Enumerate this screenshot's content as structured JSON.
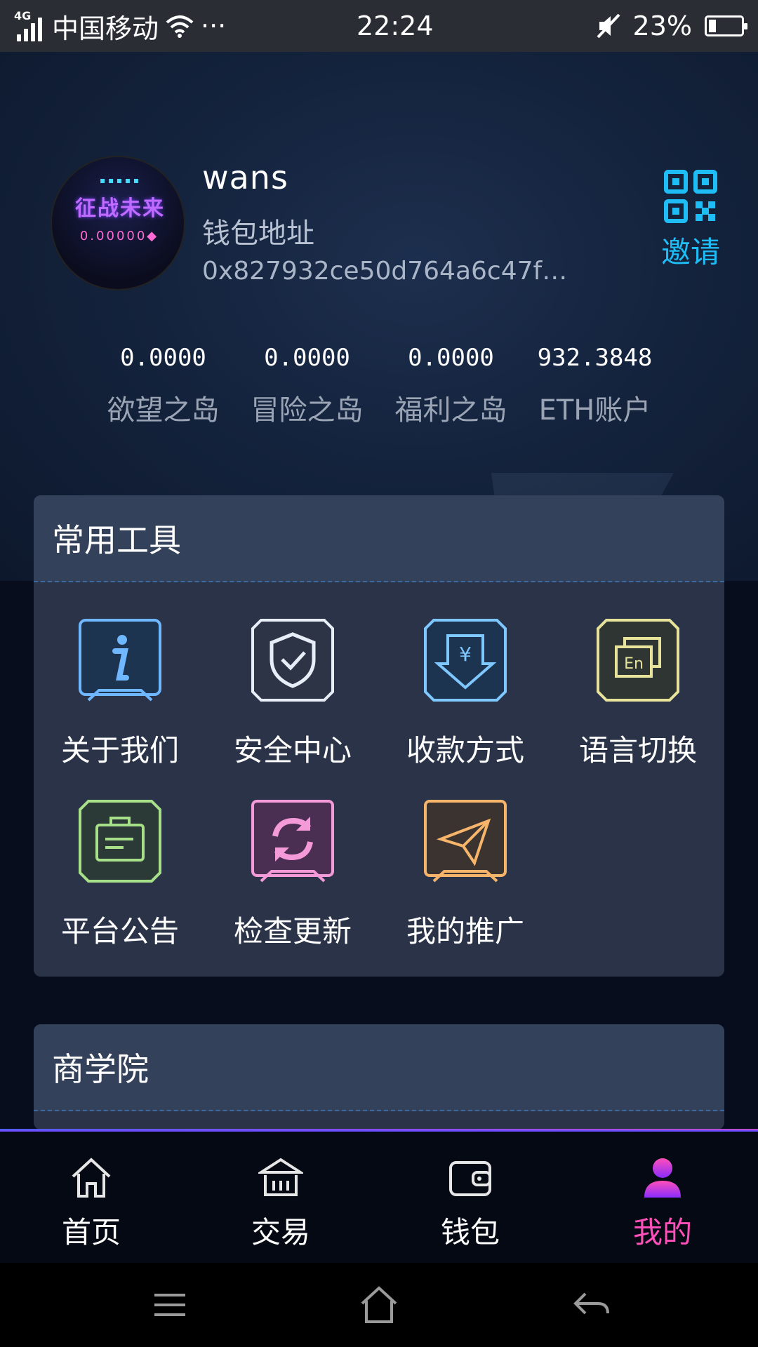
{
  "status_bar": {
    "network": "4G",
    "carrier": "中国移动",
    "more": "···",
    "time": "22:24",
    "battery": "23%",
    "battery_level": 0.23
  },
  "profile": {
    "username": "wans",
    "address_label": "钱包地址",
    "address": "0x827932ce50d764a6c47f…",
    "invite_label": "邀请",
    "avatar_text": {
      "line1": "征战未来",
      "line2": "0.00000◆"
    }
  },
  "balances": [
    {
      "value": "0.0000",
      "label": "欲望之岛"
    },
    {
      "value": "0.0000",
      "label": "冒险之岛"
    },
    {
      "value": "0.0000",
      "label": "福利之岛"
    },
    {
      "value": "932.3848",
      "label": "ETH账户"
    }
  ],
  "tools_card": {
    "title": "常用工具",
    "items": [
      {
        "label": "关于我们",
        "icon": "info-icon",
        "color": "#6fb7ff"
      },
      {
        "label": "安全中心",
        "icon": "shield-check-icon",
        "color": "#e8eef8"
      },
      {
        "label": "收款方式",
        "icon": "yen-download-icon",
        "color": "#7ec8ff"
      },
      {
        "label": "语言切换",
        "icon": "language-en-icon",
        "color": "#e8e39a"
      },
      {
        "label": "平台公告",
        "icon": "announcement-icon",
        "color": "#a8e08a"
      },
      {
        "label": "检查更新",
        "icon": "refresh-icon",
        "color": "#f59ad8"
      },
      {
        "label": "我的推广",
        "icon": "paper-plane-icon",
        "color": "#f6b56a"
      }
    ]
  },
  "academy_card": {
    "title": "商学院"
  },
  "bottom_nav": {
    "items": [
      {
        "label": "首页",
        "icon": "home-icon"
      },
      {
        "label": "交易",
        "icon": "exchange-building-icon"
      },
      {
        "label": "钱包",
        "icon": "wallet-icon"
      },
      {
        "label": "我的",
        "icon": "user-icon",
        "active": true
      }
    ],
    "active_color": "#ff4fb8"
  }
}
